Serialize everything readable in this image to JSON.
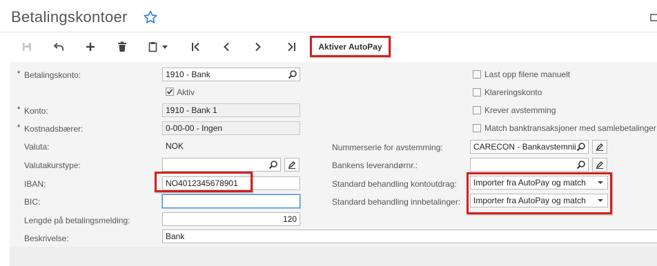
{
  "page": {
    "title": "Betalingskontoer"
  },
  "toolbar": {
    "buttons": [
      {
        "name": "save-button",
        "icon": "floppy-disk-icon",
        "enabled": false
      },
      {
        "name": "undo-button",
        "icon": "undo-icon"
      },
      {
        "name": "add-button",
        "icon": "plus-icon"
      },
      {
        "name": "delete-button",
        "icon": "trash-icon"
      },
      {
        "name": "copy-paste-button",
        "icon": "clipboard-icon"
      },
      {
        "name": "first-record-button",
        "icon": "first-icon"
      },
      {
        "name": "previous-record-button",
        "icon": "previous-icon"
      },
      {
        "name": "next-record-button",
        "icon": "next-icon"
      },
      {
        "name": "last-record-button",
        "icon": "last-icon"
      }
    ],
    "autopay_label": "Aktiver AutoPay"
  },
  "form": {
    "left": {
      "betalingskonto": {
        "label": "Betalingskonto:",
        "required": true,
        "value": "1910 - Bank"
      },
      "aktiv": {
        "label": "Aktiv",
        "checked": true
      },
      "konto": {
        "label": "Konto:",
        "required": true,
        "value": "1910 - Bank 1"
      },
      "kostnadsbaerer": {
        "label": "Kostnadsbærer:",
        "required": true,
        "value": "0-00-00 - Ingen"
      },
      "valuta": {
        "label": "Valuta:",
        "value": "NOK"
      },
      "valutakurstype": {
        "label": "Valutakurstype:",
        "value": ""
      },
      "iban": {
        "label": "IBAN:",
        "value": "NO4012345678901"
      },
      "bic": {
        "label": "BIC:",
        "value": ""
      },
      "lengde": {
        "label": "Lengde på betalingsmelding:",
        "value": "120"
      },
      "beskrivelse": {
        "label": "Beskrivelse:",
        "value": "Bank"
      }
    },
    "right": {
      "checkboxes": [
        {
          "label": "Last opp filene manuelt",
          "checked": false
        },
        {
          "label": "Klareringskonto",
          "checked": false
        },
        {
          "label": "Krever avstemming",
          "checked": false
        },
        {
          "label": "Match banktransaksjoner med samlebetalinger",
          "checked": false
        }
      ],
      "nummerserie": {
        "label": "Nummerserie for avstemming:",
        "value": "CARECON - Bankavstemnii"
      },
      "leverandor": {
        "label": "Bankens leverandørnr.:",
        "value": ""
      },
      "kontoutdrag": {
        "label": "Standard behandling kontoutdrag:",
        "value": "Importer fra AutoPay og match"
      },
      "innbetalinger": {
        "label": "Standard behandling innbetalinger:",
        "value": "Importer fra AutoPay og match"
      }
    }
  },
  "required_marker": "*",
  "colors": {
    "highlight": "#d32020",
    "focus": "#4a90d9",
    "star": "#2a7fd4"
  }
}
